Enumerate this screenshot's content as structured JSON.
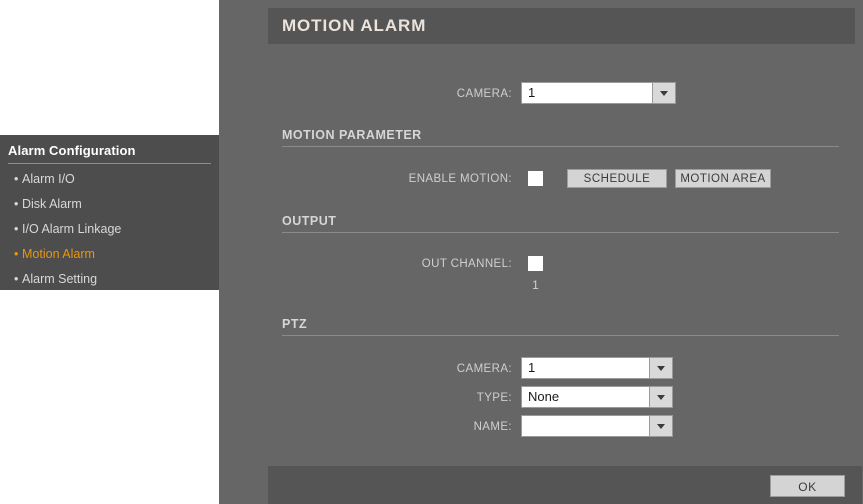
{
  "page": {
    "title": "MOTION ALARM"
  },
  "sidebar": {
    "title": "Alarm Configuration",
    "bullet": "•",
    "items": [
      {
        "label": "Alarm I/O",
        "active": false
      },
      {
        "label": "Disk Alarm",
        "active": false
      },
      {
        "label": "I/O Alarm Linkage",
        "active": false
      },
      {
        "label": "Motion Alarm",
        "active": true
      },
      {
        "label": "Alarm Setting",
        "active": false
      }
    ]
  },
  "form": {
    "camera_label": "CAMERA:",
    "camera_value": "1",
    "motion_parameter": {
      "section_label": "MOTION PARAMETER",
      "enable_motion_label": "ENABLE MOTION:",
      "enable_motion_checked": false,
      "schedule_button": "SCHEDULE",
      "motion_area_button": "MOTION AREA"
    },
    "output": {
      "section_label": "OUTPUT",
      "out_channel_label": "OUT CHANNEL:",
      "out_channel_checked": false,
      "out_channel_number": "1"
    },
    "ptz": {
      "section_label": "PTZ",
      "camera_label": "CAMERA:",
      "camera_value": "1",
      "type_label": "TYPE:",
      "type_value": "None",
      "name_label": "NAME:",
      "name_value": ""
    }
  },
  "footer": {
    "ok_label": "OK"
  },
  "colors": {
    "content_bg": "#666666",
    "panel_bg": "#555555",
    "sidebar_bg": "#4d4d4d",
    "accent": "#e8960f",
    "button_face": "#d4d4d4"
  }
}
